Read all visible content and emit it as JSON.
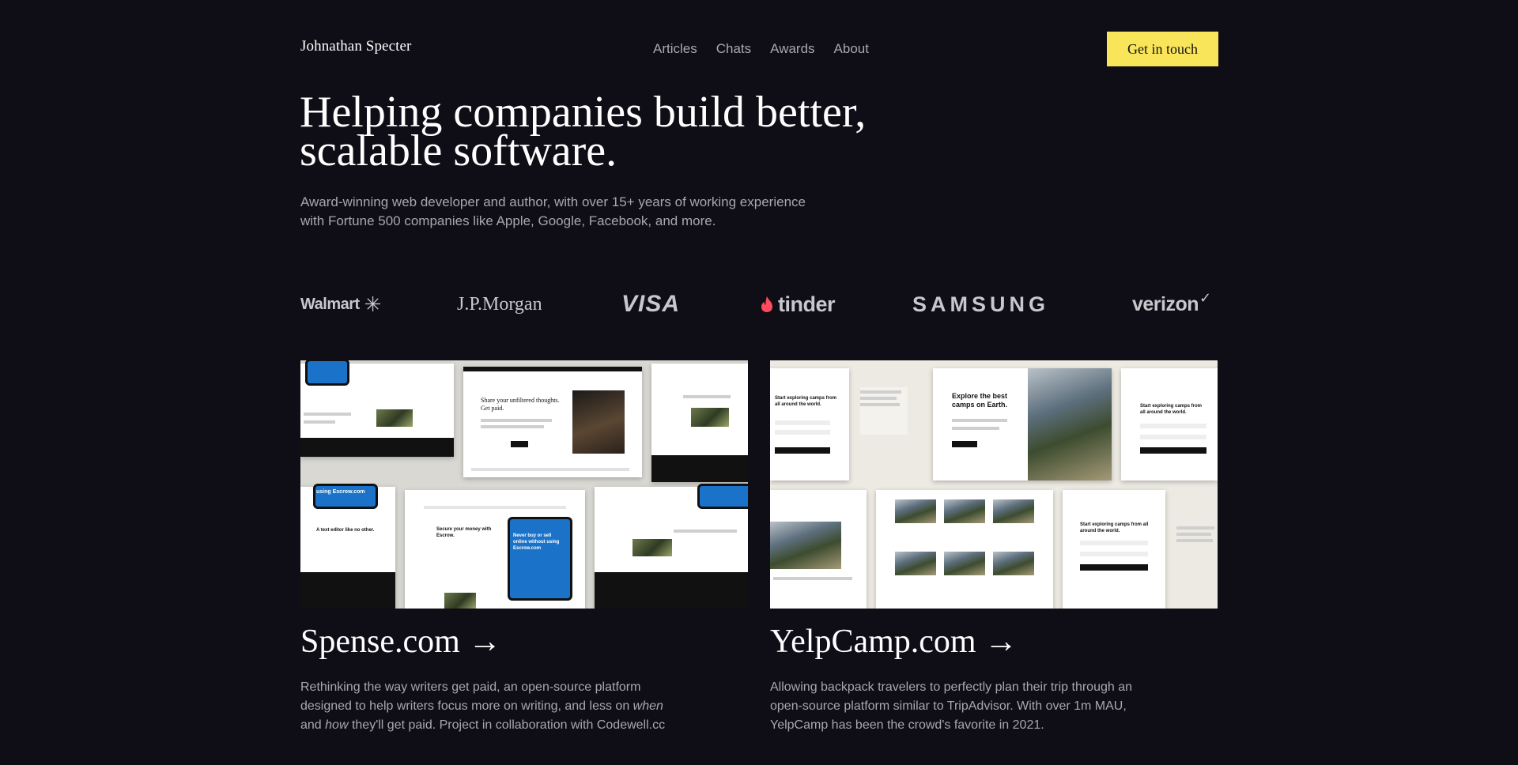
{
  "header": {
    "brand": "Johnathan Specter",
    "nav": [
      "Articles",
      "Chats",
      "Awards",
      "About"
    ],
    "cta": "Get in touch"
  },
  "hero": {
    "title": "Helping companies build better, scalable software.",
    "subtitle": "Award-winning web developer and author, with over 15+ years of working experience with Fortune 500 companies like Apple, Google, Facebook, and more."
  },
  "logos": {
    "walmart": "Walmart",
    "jpmorgan": "J.P.Morgan",
    "visa": "VISA",
    "tinder": "tinder",
    "samsung": "SAMSUNG",
    "verizon": "verizon"
  },
  "projects": [
    {
      "title": "Spense.com →",
      "desc_part1": "Rethinking the way writers get paid, an open-source platform designed to help writers focus more on writing, and less on ",
      "desc_em1": "when",
      "desc_mid": " and ",
      "desc_em2": "how",
      "desc_part2": " they'll get paid. Project in collaboration with Codewell.cc",
      "preview": {
        "headline": "Share your unfiltered thoughts. Get paid.",
        "secure": "Secure your money with Escrow.",
        "phone_text": "Never buy or sell online without using Escrow.com",
        "editor": "A text editor like no other.",
        "escrow_tag": "using Escrow.com"
      }
    },
    {
      "title": "YelpCamp.com →",
      "desc": "Allowing backpack travelers to perfectly plan their trip through an open-source platform similar to TripAdvisor. With over 1m MAU, YelpCamp has been the crowd's favorite in 2021.",
      "preview": {
        "headline": "Explore the best camps on Earth.",
        "start": "Start exploring camps from all around the world."
      }
    }
  ],
  "colors": {
    "background": "#0f0e17",
    "accent": "#f9e559",
    "muted_text": "#a7a7ad"
  }
}
